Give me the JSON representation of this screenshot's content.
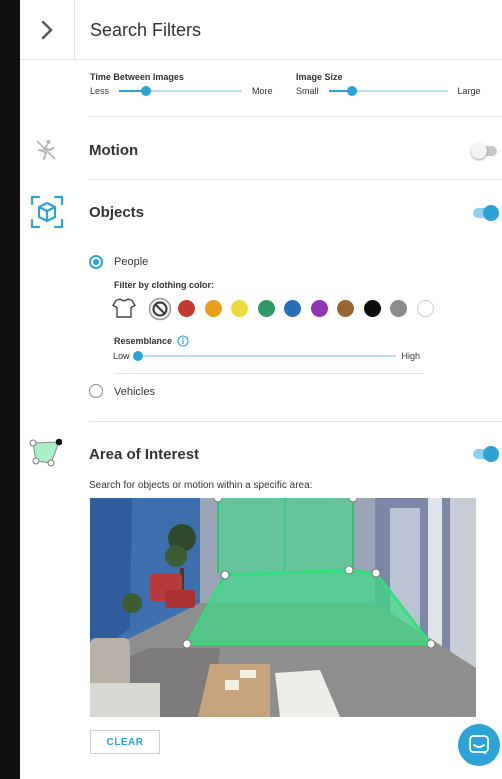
{
  "header": {
    "title": "Search Filters"
  },
  "sliders": {
    "time_between_images": {
      "label": "Time Between Images",
      "min_label": "Less",
      "max_label": "More",
      "value": 0.22
    },
    "image_size": {
      "label": "Image Size",
      "min_label": "Small",
      "max_label": "Large",
      "value": 0.2
    }
  },
  "motion": {
    "label": "Motion",
    "enabled": false
  },
  "objects": {
    "label": "Objects",
    "enabled": true,
    "people": {
      "label": "People",
      "selected": true
    },
    "clothing": {
      "label": "Filter by clothing color:",
      "colors": [
        "#c53a2e",
        "#e5a11b",
        "#ecd93a",
        "#2f9a67",
        "#2a6fb6",
        "#8f35b3",
        "#9a6532",
        "#0d0d0d",
        "#8b8b8b",
        "#ffffff"
      ]
    },
    "resemblance": {
      "label": "Resemblance",
      "min_label": "Low",
      "max_label": "High",
      "value": 0.0
    },
    "vehicles": {
      "label": "Vehicles",
      "selected": false
    }
  },
  "area_of_interest": {
    "label": "Area of Interest",
    "enabled": true,
    "description": "Search for objects or motion within a specific area:",
    "clear_label": "CLEAR"
  },
  "colors": {
    "accent": "#2ba3d6",
    "area_fill": "#3ddc84"
  }
}
